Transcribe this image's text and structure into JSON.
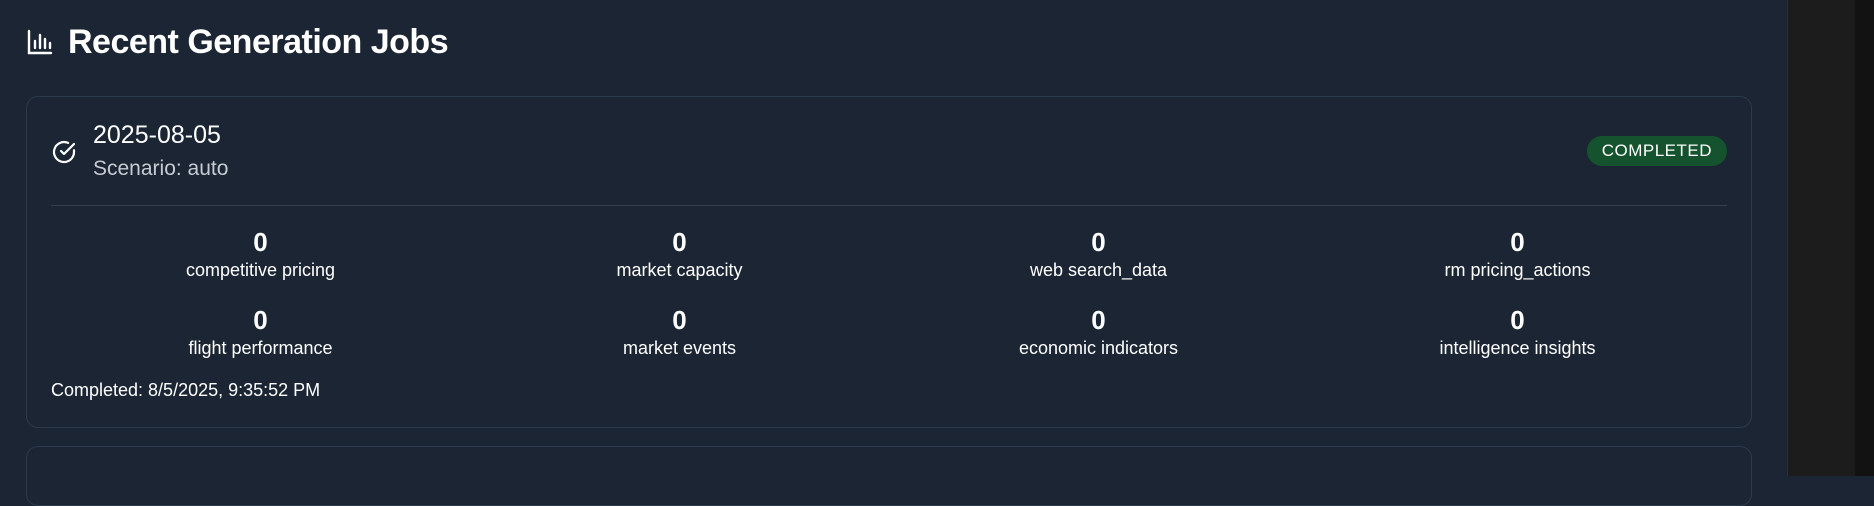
{
  "section": {
    "title": "Recent Generation Jobs",
    "icon": "bar-chart-icon"
  },
  "jobs": [
    {
      "date": "2025-08-05",
      "scenario": "Scenario: auto",
      "status": "COMPLETED",
      "status_color": "#14532d",
      "status_icon": "check-circle-icon",
      "stats": [
        {
          "value": "0",
          "label": "competitive pricing"
        },
        {
          "value": "0",
          "label": "market capacity"
        },
        {
          "value": "0",
          "label": "web search_data"
        },
        {
          "value": "0",
          "label": "rm pricing_actions"
        },
        {
          "value": "0",
          "label": "flight performance"
        },
        {
          "value": "0",
          "label": "market events"
        },
        {
          "value": "0",
          "label": "economic indicators"
        },
        {
          "value": "0",
          "label": "intelligence insights"
        }
      ],
      "completed": "Completed: 8/5/2025, 9:35:52 PM"
    }
  ],
  "colors": {
    "background": "#1b2533",
    "card_border": "#2c3a4c",
    "badge": "#14532d"
  }
}
